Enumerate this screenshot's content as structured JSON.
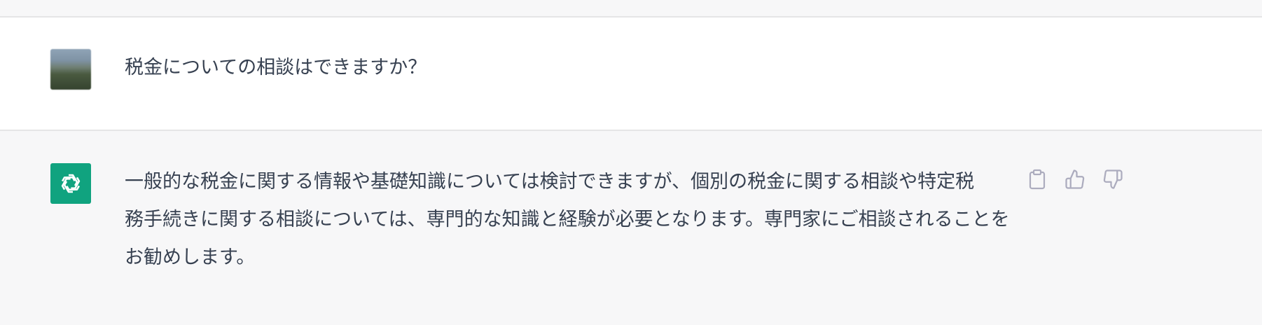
{
  "conversation": {
    "user_message": {
      "avatar": "user-profile-photo",
      "text": "税金についての相談はできますか？"
    },
    "assistant_message": {
      "avatar": "openai-logo-icon",
      "lines": [
        "一般的な税金に関する情報や基礎知識については検討できますが、個別の税金に関する相談や特定税",
        "務手続きに関する相談については、専門的な知識と経験が必要となります。専門家にご相談されることを",
        "お勧めします。"
      ],
      "actions": [
        "clipboard-icon",
        "thumbs-up-icon",
        "thumbs-down-icon"
      ]
    }
  },
  "colors": {
    "assistant_avatar_bg": "#10a37f",
    "user_row_bg": "#ffffff",
    "assistant_row_bg": "#f7f7f8",
    "text": "#374151",
    "icon": "#acacbe"
  }
}
